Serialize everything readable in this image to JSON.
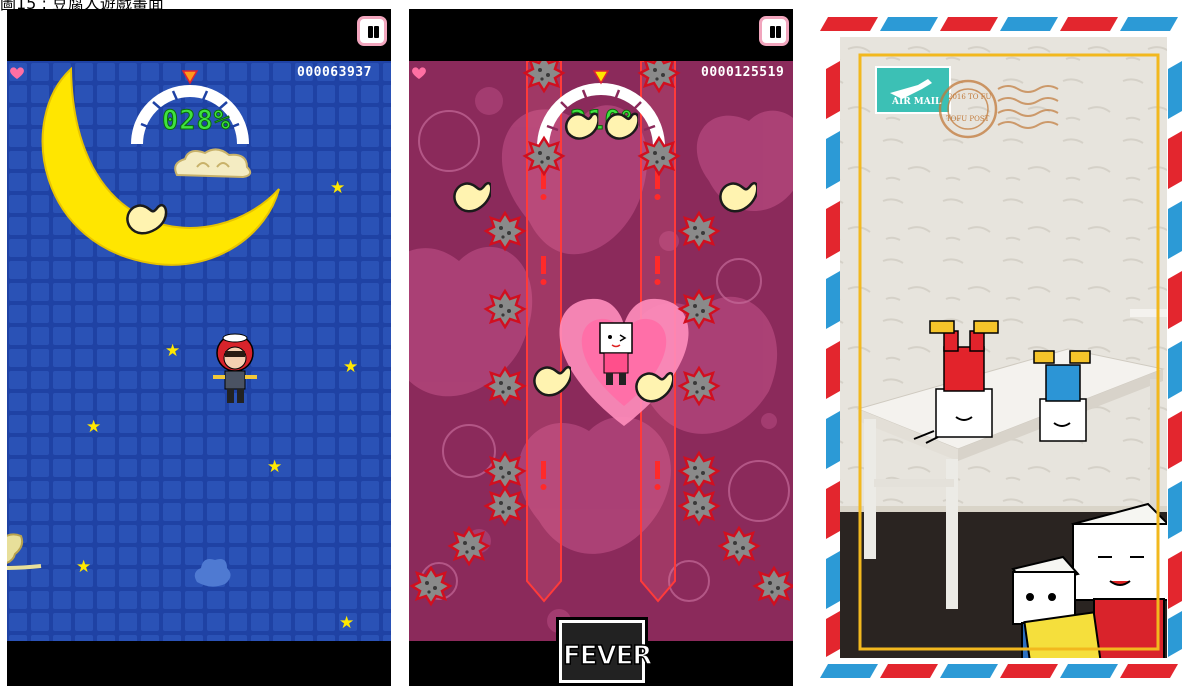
{
  "caption": "圖15 : 豆腐人遊戲畫面",
  "panels": [
    {
      "name": "night-sky-stage",
      "score": "000063937",
      "gauge_percent_text": "028%",
      "pause_button": "pause",
      "background_color": "#1f42a4"
    },
    {
      "name": "fever-stage",
      "score": "0000125519",
      "gauge_percent_text": "210%",
      "pause_button": "pause",
      "fever_label": "FEVER",
      "background_color": "#8e2a5e"
    },
    {
      "name": "ar-photo-postcard",
      "stamp_label": "AIR MAIL",
      "postmark_lines": [
        "2016 TO FU",
        "TOFU POST"
      ]
    }
  ],
  "colors": {
    "heart": "#ff6fa3",
    "gauge_text": "#3fe33f",
    "postcard_red": "#e3262e",
    "postcard_blue": "#2c9ad6",
    "postcard_frame": "#f2b81e"
  }
}
